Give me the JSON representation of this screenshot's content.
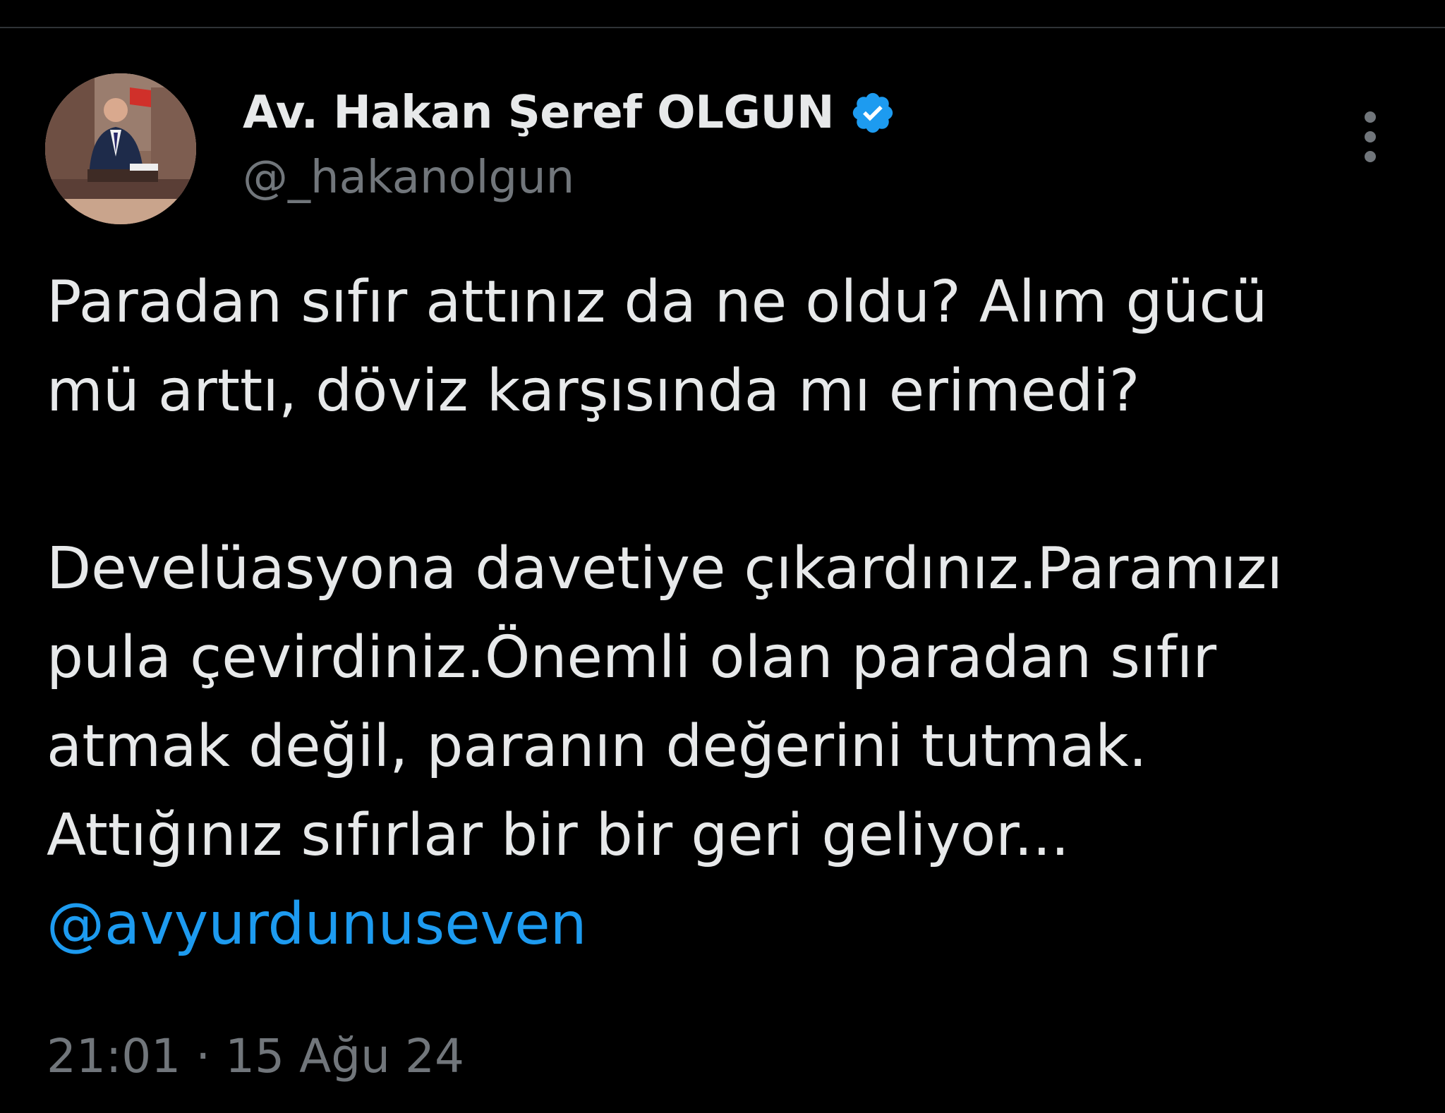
{
  "tweet": {
    "author": {
      "display_name": "Av. Hakan Şeref OLGUN",
      "handle": "@_hakanolgun",
      "verified_icon": "verified-badge-icon",
      "avatar": "avatar-photo"
    },
    "more_icon": "more-vertical-icon",
    "text_lines": [
      "Paradan sıfır attınız da ne oldu? Alım gücü",
      "mü arttı, döviz karşısında mı erimedi?",
      "",
      "Develüasyona davetiye çıkardınız.Paramızı",
      "pula çevirdiniz.Önemli olan paradan sıfır",
      "atmak değil, paranın değerini tutmak.",
      "Attığınız sıfırlar bir bir geri geliyor..."
    ],
    "mention": "@avyurdunuseven",
    "time": "21:01",
    "separator": "·",
    "date": "15 Ağu 24"
  },
  "colors": {
    "background": "#000000",
    "text": "#e7e9ea",
    "secondary": "#71767b",
    "link": "#1d9bf0",
    "verified": "#1d9bf0"
  }
}
